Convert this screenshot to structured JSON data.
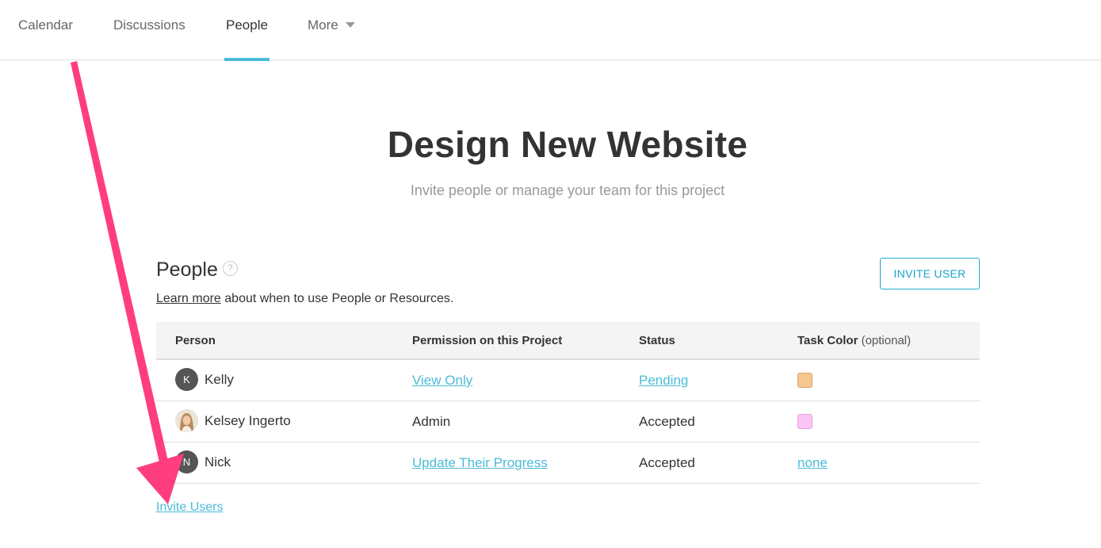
{
  "nav": {
    "tabs": [
      {
        "label": "Calendar"
      },
      {
        "label": "Discussions"
      },
      {
        "label": "People",
        "active": true
      },
      {
        "label": "More"
      }
    ],
    "more_icon": "caret-down-icon"
  },
  "header": {
    "title": "Design New Website",
    "subtitle": "Invite people or manage your team for this project"
  },
  "section": {
    "title": "People",
    "help_icon": "question-circle-icon",
    "help_glyph": "?",
    "learn_link": "Learn more",
    "learn_text": " about when to use People or Resources.",
    "invite_button": "INVITE USER"
  },
  "table": {
    "columns": {
      "person": "Person",
      "permission": "Permission on this Project",
      "status": "Status",
      "task_color": "Task Color",
      "task_color_note": "(optional)"
    },
    "rows": [
      {
        "initial": "K",
        "name": "Kelly",
        "permission": "View Only",
        "status": "Pending",
        "color_hex": "#f6c690"
      },
      {
        "name": "Kelsey Ingerto",
        "permission": "Admin",
        "status": "Accepted",
        "color_hex": "#fbc5f3"
      },
      {
        "initial": "N",
        "name": "Nick",
        "permission": "Update Their Progress",
        "status": "Accepted",
        "color_text": "none"
      }
    ]
  },
  "footer": {
    "invite_users": "Invite Users"
  },
  "colors": {
    "accent": "#4bbbd8",
    "button_border": "#22a8cf",
    "annotation_arrow": "#ff3d7f"
  }
}
